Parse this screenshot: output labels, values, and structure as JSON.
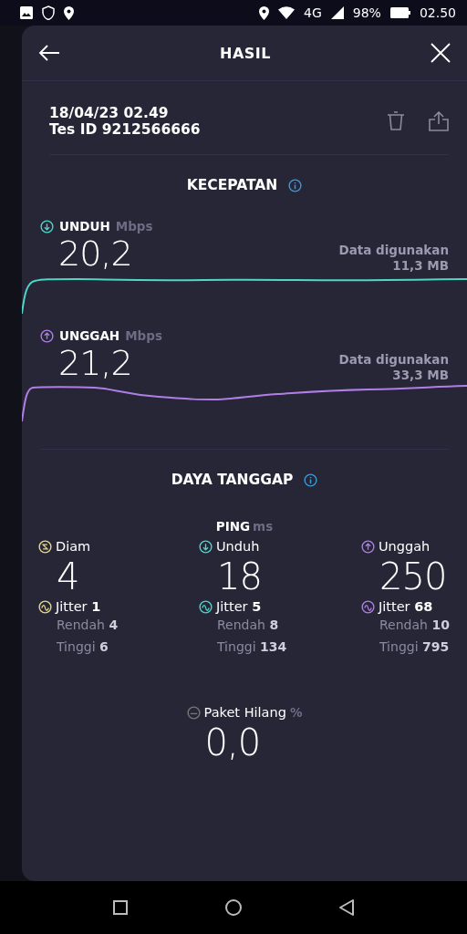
{
  "status_bar": {
    "network": "4G",
    "battery": "98%",
    "time": "02.50"
  },
  "header": {
    "title": "HASIL"
  },
  "test": {
    "date": "18/04/23 02.49",
    "id": "Tes ID 9212566666"
  },
  "speed": {
    "title": "KECEPATAN",
    "results": [
      {
        "kind": "download",
        "label": "UNDUH",
        "unit": "Mbps",
        "value": "20,2",
        "data_label": "Data digunakan",
        "data_value": "11,3 MB"
      },
      {
        "kind": "upload",
        "label": "UNGGAH",
        "unit": "Mbps",
        "value": "21,2",
        "data_label": "Data digunakan",
        "data_value": "33,3 MB"
      }
    ]
  },
  "responsiveness": {
    "title": "DAYA TANGGAP",
    "ping_label": "PING",
    "ping_unit": "ms",
    "columns": [
      {
        "kind": "idle",
        "label": "Diam",
        "value": "4",
        "jitter_label": "Jitter",
        "jitter": "1",
        "low_label": "Rendah",
        "low": "4",
        "high_label": "Tinggi",
        "high": "6"
      },
      {
        "kind": "download",
        "label": "Unduh",
        "value": "18",
        "jitter_label": "Jitter",
        "jitter": "5",
        "low_label": "Rendah",
        "low": "8",
        "high_label": "Tinggi",
        "high": "134"
      },
      {
        "kind": "upload",
        "label": "Unggah",
        "value": "250",
        "jitter_label": "Jitter",
        "jitter": "68",
        "low_label": "Rendah",
        "low": "10",
        "high_label": "Tinggi",
        "high": "795"
      }
    ]
  },
  "packet_loss": {
    "label": "Paket Hilang",
    "unit": "%",
    "value": "0,0"
  }
}
